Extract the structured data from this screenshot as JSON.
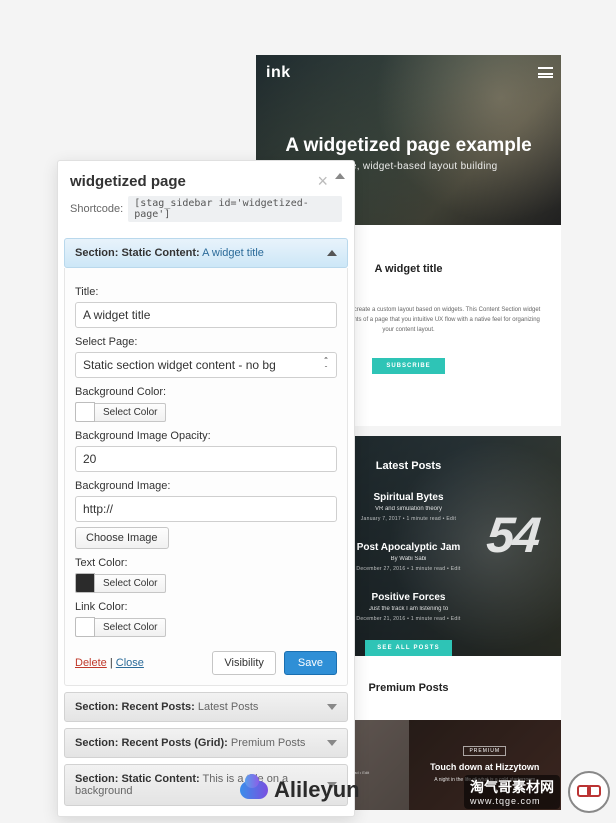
{
  "preview": {
    "brand": "ink",
    "hero_title": "A widgetized page example",
    "hero_sub": "Intuitive, widget-based layout building",
    "widget_title": "A widget title",
    "widget_desc": "template that enables you to create a custom layout based on widgets. This Content Section widget that simply outputs the contents of a page that you intuitive UX flow with a native feel for organizing your content layout.",
    "subscribe": "SUBSCRIBE",
    "latest_head": "Latest Posts",
    "latest_items": [
      {
        "title": "Spiritual Bytes",
        "sub": "VR and simulation theory",
        "meta": "January 7, 2017 • 1 minute read • Edit"
      },
      {
        "title": "Post Apocalyptic Jam",
        "sub": "By Wabi Sabi",
        "meta": "December 27, 2016 • 1 minute read • Edit"
      },
      {
        "title": "Positive Forces",
        "sub": "Just the track I am listening to",
        "meta": "December 21, 2016 • 1 minute read • Edit"
      }
    ],
    "see_all": "SEE ALL POSTS",
    "premium_head": "Premium Posts",
    "cards": [
      {
        "tag": "PREMIUM",
        "title": "",
        "sub": "",
        "meta": "December 13, 2016 • 1 minute read • Edit"
      },
      {
        "tag": "PREMIUM",
        "title": "Touch down at Hizzytown",
        "sub": "A night in the life of what is a cold starterroom",
        "meta": ""
      }
    ]
  },
  "admin": {
    "title": "widgetized page",
    "shortcode_label": "Shortcode:",
    "shortcode": "[stag_sidebar id='widgetized-page']",
    "sections": {
      "static1": {
        "head_label": "Section: Static Content:",
        "head_value": "A widget title",
        "title_label": "Title:",
        "title_value": "A widget title",
        "select_page_label": "Select Page:",
        "select_page_value": "Static section widget content - no bg",
        "bg_color_label": "Background Color:",
        "select_color": "Select Color",
        "bg_opacity_label": "Background Image Opacity:",
        "bg_opacity_value": "20",
        "bg_image_label": "Background Image:",
        "bg_image_value": "http://",
        "choose_image": "Choose Image",
        "text_color_label": "Text Color:",
        "link_color_label": "Link Color:",
        "delete": "Delete",
        "close": "Close",
        "visibility": "Visibility",
        "save": "Save"
      },
      "recent_posts": {
        "head_label": "Section: Recent Posts:",
        "head_value": "Latest Posts"
      },
      "recent_posts_grid": {
        "head_label": "Section: Recent Posts (Grid):",
        "head_value": "Premium Posts"
      },
      "static2": {
        "head_label": "Section: Static Content:",
        "head_value": "This is a title on a background"
      }
    }
  },
  "watermarks": {
    "left": "Alileyun",
    "right_main": "淘气哥素材网",
    "right_sub": "www.tqge.com"
  }
}
